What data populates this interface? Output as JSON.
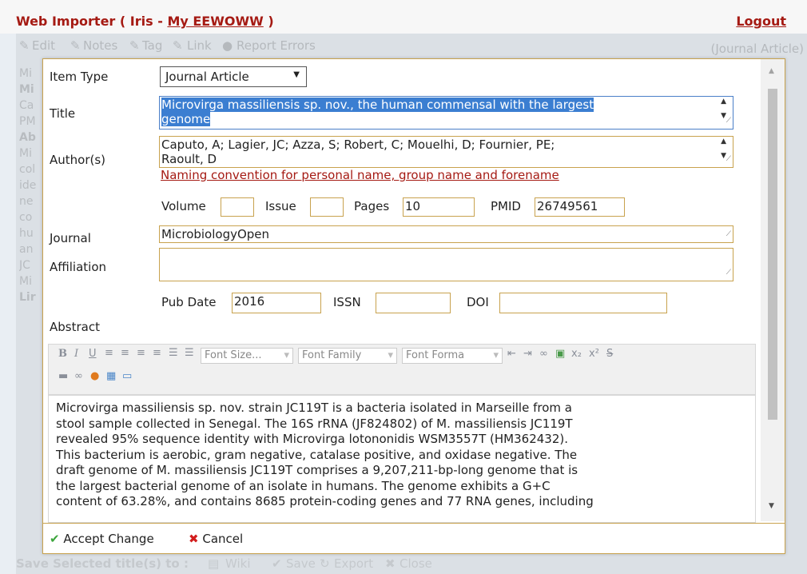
{
  "header": {
    "app_name": "Web Importer",
    "paren_open": "(",
    "user": "Iris",
    "dash": "-",
    "library_link": "My EEWOWW",
    "paren_close": ")",
    "logout": "Logout"
  },
  "bg_toolbar": {
    "edit": "Edit",
    "notes": "Notes",
    "tag": "Tag",
    "link": "Link",
    "report": "Report Errors",
    "item_type": "(Journal Article)"
  },
  "bg_left": [
    "Mi",
    "Mi",
    "Ca",
    "PM",
    "Ab",
    "Mi",
    "col",
    "ide",
    "ne",
    "co",
    "hu",
    "an",
    "JC",
    "Mi",
    "Lir"
  ],
  "bg_bottom": {
    "save_selected": "Save Selected title(s) to :",
    "wiki": "Wiki",
    "save": "Save",
    "export": "Export",
    "close": "Close"
  },
  "form": {
    "item_type_label": "Item Type",
    "item_type_value": "Journal Article",
    "title_label": "Title",
    "title_value": "Microvirga massiliensis sp. nov., the human commensal with the largest",
    "title_value_line2": "genome",
    "authors_label": "Author(s)",
    "authors_value": "Caputo, A; Lagier, JC; Azza, S; Robert, C; Mouelhi, D; Fournier, PE;",
    "authors_value_line2": "Raoult, D",
    "naming_link": "Naming convention for personal name, group name and forename",
    "volume_label": "Volume",
    "volume_value": "",
    "issue_label": "Issue",
    "issue_value": "",
    "pages_label": "Pages",
    "pages_value": "10",
    "pmid_label": "PMID",
    "pmid_value": "26749561",
    "journal_label": "Journal",
    "journal_value": "MicrobiologyOpen",
    "affiliation_label": "Affiliation",
    "affiliation_value": "",
    "pubdate_label": "Pub Date",
    "pubdate_value": "2016",
    "issn_label": "ISSN",
    "issn_value": "",
    "doi_label": "DOI",
    "doi_value": "",
    "abstract_label": "Abstract"
  },
  "editor": {
    "font_size": "Font Size...",
    "font_family": "Font Family",
    "font_format": "Font Forma",
    "abstract_lines": [
      "Microvirga massiliensis sp. nov. strain JC119T is a bacteria isolated in Marseille from a",
      "stool sample collected in Senegal. The 16S rRNA (JF824802) of M. massiliensis JC119T",
      "revealed 95% sequence identity with Microvirga lotononidis WSM3557T (HM362432).",
      "This bacterium is aerobic, gram negative, catalase positive, and oxidase negative. The",
      "draft genome of M. massiliensis JC119T comprises a 9,207,211-bp-long genome that is",
      "the largest bacterial genome of an isolate in humans. The genome exhibits a G+C",
      "content of 63.28%, and contains 8685 protein-coding genes and 77 RNA genes, including"
    ]
  },
  "footer": {
    "accept": "Accept Change",
    "cancel": "Cancel"
  }
}
